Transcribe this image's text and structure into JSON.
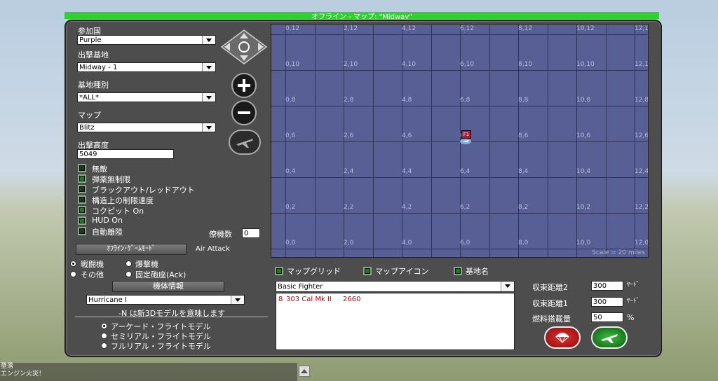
{
  "window": {
    "title": "オフライン - マップ: \"Midway\""
  },
  "left": {
    "country_label": "参加国",
    "country_value": "Purple",
    "base_label": "出撃基地",
    "base_value": "Midway - 1",
    "base_type_label": "基地種別",
    "base_type_value": "*ALL*",
    "map_label": "マップ",
    "map_value": "Blitz",
    "altitude_label": "出撃高度",
    "altitude_value": "5049",
    "options": [
      {
        "label": "無敵",
        "checked": false
      },
      {
        "label": "弾薬無制限",
        "checked": true
      },
      {
        "label": "ブラックアウト/レッドアウト",
        "checked": false
      },
      {
        "label": "構造上の制限速度",
        "checked": false
      },
      {
        "label": "コクピット On",
        "checked": true
      },
      {
        "label": "HUD On",
        "checked": true
      },
      {
        "label": "自動離陸",
        "checked": false
      }
    ],
    "wingmen_label": "僚機数",
    "wingmen_value": "0",
    "game_mode_button": "ｵﾌﾗｲﾝ･ｹﾞｰﾑﾓｰﾄﾞ",
    "game_mode_value": "Air Attack",
    "aircraft_types": [
      {
        "label": "戦闘機",
        "selected": true
      },
      {
        "label": "爆撃機",
        "selected": false
      },
      {
        "label": "その他",
        "selected": false
      },
      {
        "label": "固定砲座(Ack)",
        "selected": false
      }
    ],
    "aircraft_info_button": "機体情報",
    "aircraft_value": "Hurricane I",
    "model_note": "-N は新3Dモデルを意味します",
    "flight_models": [
      {
        "label": "アーケード・フライトモデル",
        "selected": true
      },
      {
        "label": "セミリアル・フライトモデル",
        "selected": false
      },
      {
        "label": "フルリアル・フライトモデル",
        "selected": false
      }
    ]
  },
  "map": {
    "col_labels": [
      "0",
      "2",
      "4",
      "6",
      "8",
      "10",
      "12"
    ],
    "row_labels": [
      "12",
      "10",
      "8",
      "6",
      "4",
      "2",
      "0"
    ],
    "marker_label": "F1",
    "scale": "Scale = 20 miles"
  },
  "bottom": {
    "toggles": [
      {
        "label": "マップグリッド",
        "checked": true
      },
      {
        "label": "マップアイコン",
        "checked": true
      },
      {
        "label": "基地名",
        "checked": true
      }
    ],
    "loadout_value": "Basic Fighter",
    "loadout_line": {
      "count": "8",
      "weapon": "303 Cal Mk II",
      "ammo": "2660"
    },
    "convergence2_label": "収束距離2",
    "convergence2_value": "300",
    "convergence1_label": "収束距離1",
    "convergence1_value": "300",
    "fuel_label": "燃料搭載量",
    "fuel_value": "50",
    "unit_yard": "ﾔｰﾄﾞ",
    "unit_pct": "%"
  },
  "chat": {
    "lines": [
      "墜落",
      "エンジン火災！"
    ]
  },
  "colors": {
    "title_bar": "#2ed12e",
    "panel": "#4d4d4d",
    "map": "#575f95",
    "ammo_text": "#c00000"
  }
}
